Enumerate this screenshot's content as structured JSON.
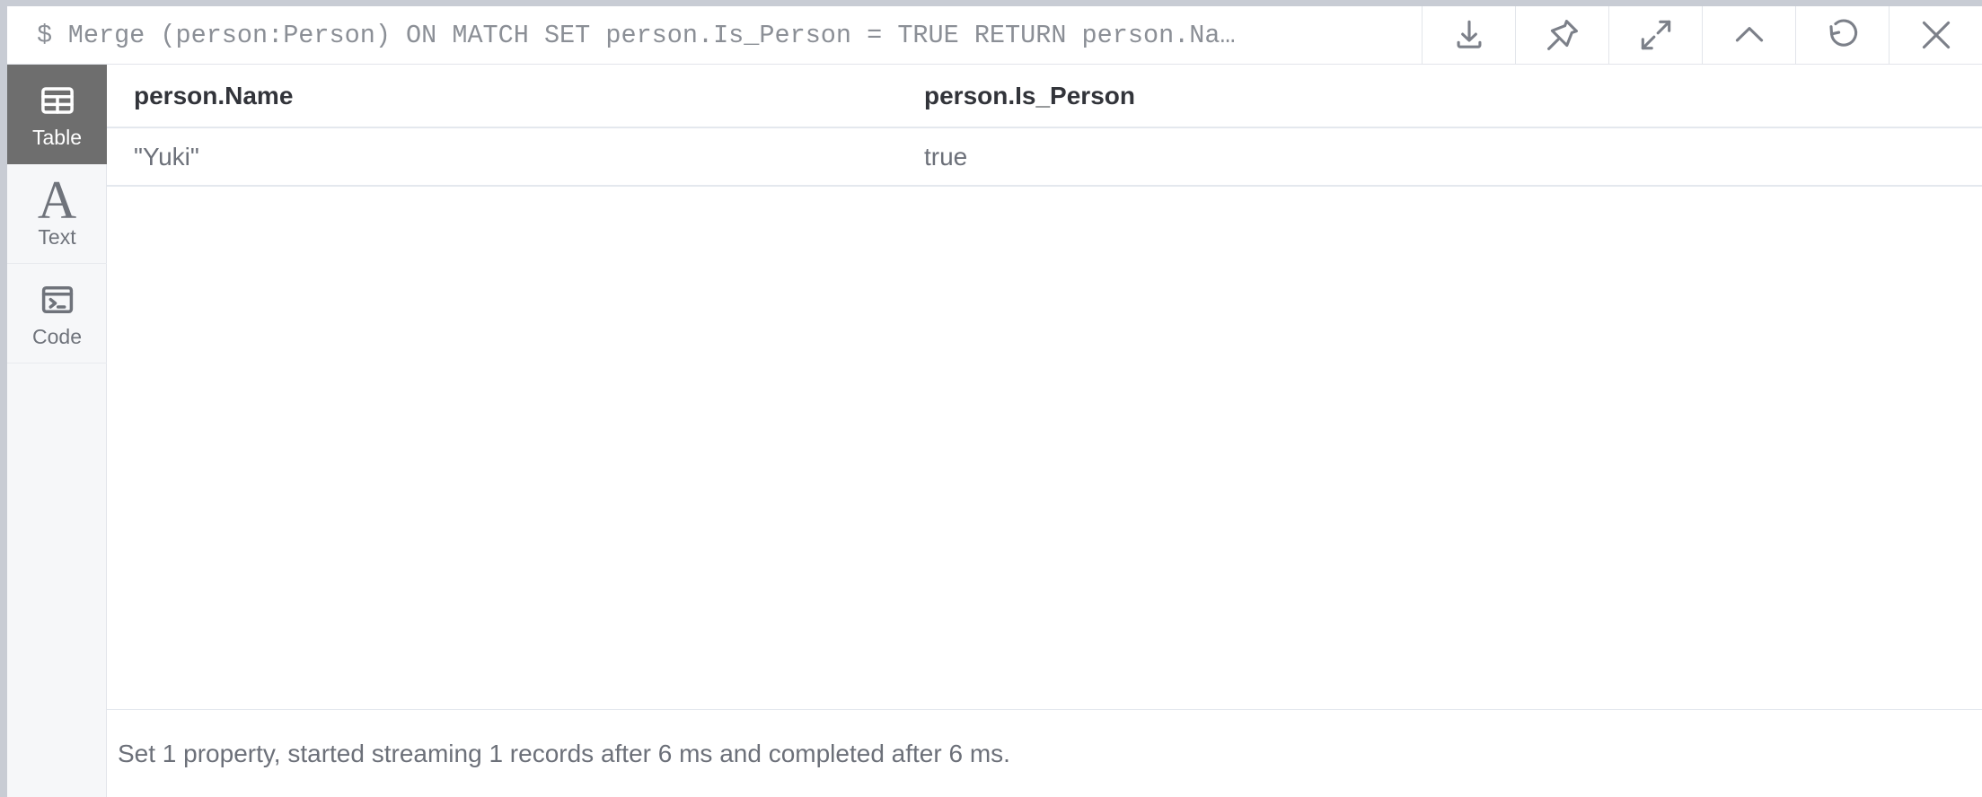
{
  "query_bar": {
    "prompt": "$",
    "query": "Merge (person:Person) ON MATCH SET person.Is_Person = TRUE RETURN person.Na…",
    "buttons": [
      {
        "name": "download-button",
        "icon": "download-icon",
        "title": "Download"
      },
      {
        "name": "pin-button",
        "icon": "pin-icon",
        "title": "Pin"
      },
      {
        "name": "expand-button",
        "icon": "expand-icon",
        "title": "Expand"
      },
      {
        "name": "collapse-button",
        "icon": "chevron-up-icon",
        "title": "Collapse"
      },
      {
        "name": "rerun-button",
        "icon": "refresh-icon",
        "title": "Rerun"
      },
      {
        "name": "close-button",
        "icon": "close-icon",
        "title": "Close"
      }
    ]
  },
  "sidebar": {
    "items": [
      {
        "label": "Table",
        "icon": "table-icon",
        "active": true
      },
      {
        "label": "Text",
        "icon": "text-a-icon",
        "active": false
      },
      {
        "label": "Code",
        "icon": "terminal-icon",
        "active": false
      }
    ]
  },
  "results": {
    "columns": [
      "person.Name",
      "person.Is_Person"
    ],
    "rows": [
      [
        "\"Yuki\"",
        "true"
      ]
    ]
  },
  "status": {
    "message": "Set 1 property, started streaming 1 records after 6 ms and completed after 6 ms."
  },
  "colors": {
    "active_tab_bg": "#6e6e6e",
    "sidebar_bg": "#f6f7f9",
    "border": "#e2e5ea",
    "row_border": "#e4e8ee",
    "text_muted": "#6c7079",
    "text_strong": "#32343a",
    "chrome": "#c8ccd4"
  }
}
